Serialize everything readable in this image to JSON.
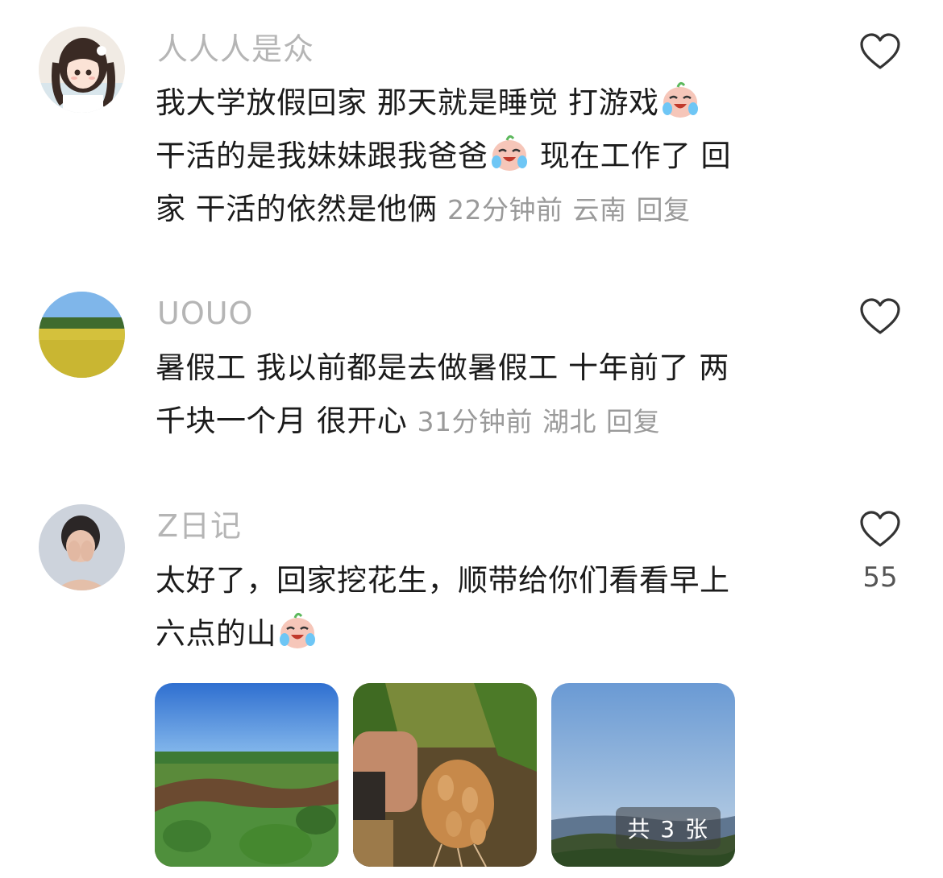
{
  "comments": [
    {
      "username": "人人人是众",
      "lines": [
        "我大学放假回家 那天就是睡觉 打游戏",
        "干活的是我妹妹跟我爸爸",
        " 现在工作了 回",
        "家 干活的依然是他俩"
      ],
      "time": "22分钟前",
      "location": "云南",
      "reply": "回复",
      "avatar": "anime-girl-avatar",
      "emoji": "crying-laughing-emoji"
    },
    {
      "username": "UOUO",
      "lines": [
        "暑假工 我以前都是去做暑假工 十年前了 两",
        "千块一个月 很开心"
      ],
      "time": "31分钟前",
      "location": "湖北",
      "reply": "回复",
      "avatar": "rice-field-avatar"
    },
    {
      "username": "Z日记",
      "lines": [
        "太好了，回家挖花生，顺带给你们看看早上",
        "六点的山"
      ],
      "like_count": "55",
      "avatar": "woman-covering-face-avatar",
      "images": [
        "peanut-field-photo",
        "peanut-harvest-photo",
        "morning-mountain-photo"
      ],
      "image_count_badge": "共 3 张",
      "emoji": "crying-laughing-emoji"
    }
  ],
  "icons": {
    "like": "heart-outline-icon"
  },
  "colors": {
    "username": "#b5b5b5",
    "meta": "#9a9a9a",
    "text": "#1b1b1b"
  }
}
